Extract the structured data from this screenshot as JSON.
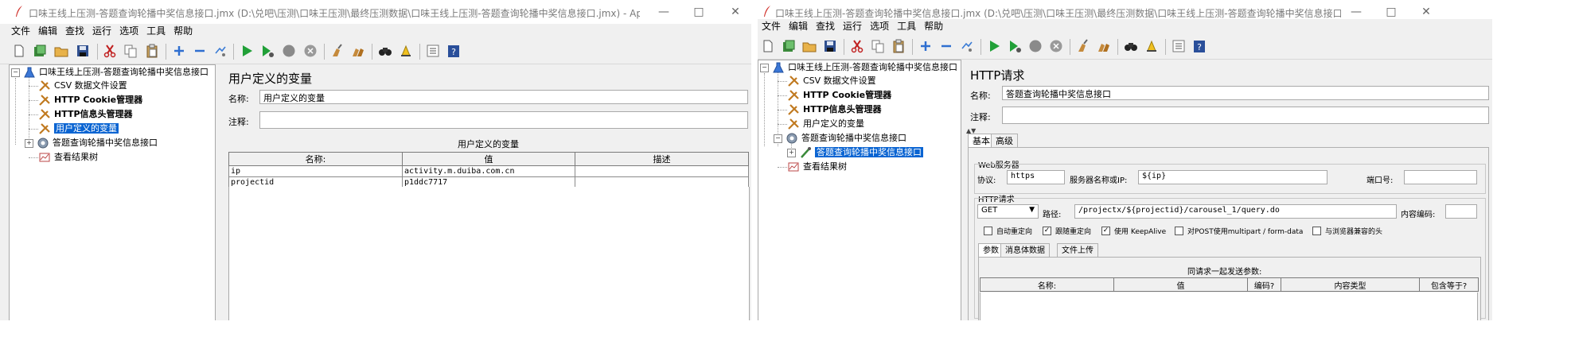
{
  "window1": {
    "title": "口味王线上压测-答题查询轮播中奖信息接口.jmx (D:\\兑吧\\压测\\口味王压测\\最终压测数据\\口味王线上压测-答题查询轮播中奖信息接口.jmx) - Apache JMet...",
    "menu": [
      "文件",
      "编辑",
      "查找",
      "运行",
      "选项",
      "工具",
      "帮助"
    ],
    "tree": {
      "root": "口味王线上压测-答题查询轮播中奖信息接口",
      "items": [
        "CSV 数据文件设置",
        "HTTP Cookie管理器",
        "HTTP信息头管理器",
        "用户定义的变量",
        "答题查询轮播中奖信息接口",
        "查看结果树"
      ]
    },
    "panel": {
      "title": "用户定义的变量",
      "name_label": "名称:",
      "name_value": "用户定义的变量",
      "comment_label": "注释:",
      "comment_value": "",
      "table_caption": "用户定义的变量",
      "columns": [
        "名称:",
        "值",
        "描述"
      ],
      "rows": [
        [
          "ip",
          "activity.m.duiba.com.cn",
          ""
        ],
        [
          "projectid",
          "p1ddc7717",
          ""
        ]
      ]
    }
  },
  "window2": {
    "title": "口味王线上压测-答题查询轮播中奖信息接口.jmx (D:\\兑吧\\压测\\口味王压测\\最终压测数据\\口味王线上压测-答题查询轮播中奖信息接口.jmx) - Apache JMet...",
    "menu": [
      "文件",
      "编辑",
      "查找",
      "运行",
      "选项",
      "工具",
      "帮助"
    ],
    "tree": {
      "root": "口味王线上压测-答题查询轮播中奖信息接口",
      "items": [
        "CSV 数据文件设置",
        "HTTP Cookie管理器",
        "HTTP信息头管理器",
        "用户定义的变量",
        "答题查询轮播中奖信息接口",
        "答题查询轮播中奖信息接口",
        "查看结果树"
      ]
    },
    "panel": {
      "title": "HTTP请求",
      "name_label": "名称:",
      "name_value": "答题查询轮播中奖信息接口",
      "comment_label": "注释:",
      "comment_value": "",
      "tabs": [
        "基本",
        "高级"
      ],
      "web_server_label": "Web服务器",
      "protocol_label": "协议:",
      "protocol_value": "https",
      "server_label": "服务器名称或IP:",
      "server_value": "${ip}",
      "port_label": "端口号:",
      "port_value": "",
      "http_request_label": "HTTP请求",
      "method": "GET",
      "path_label": "路径:",
      "path_value": "/projectx/${projectid}/carousel_1/query.do",
      "encoding_label": "内容编码:",
      "encoding_value": "",
      "checkboxes": [
        {
          "label": "自动重定向",
          "checked": false
        },
        {
          "label": "跟随重定向",
          "checked": true
        },
        {
          "label": "使用 KeepAlive",
          "checked": true
        },
        {
          "label": "对POST使用multipart / form-data",
          "checked": false
        },
        {
          "label": "与浏览器兼容的头",
          "checked": false
        }
      ],
      "subtabs": [
        "参数",
        "消息体数据",
        "文件上传"
      ],
      "params_caption": "同请求一起发送参数:",
      "param_columns": [
        "名称:",
        "值",
        "编码?",
        "内容类型",
        "包含等于?"
      ]
    }
  }
}
